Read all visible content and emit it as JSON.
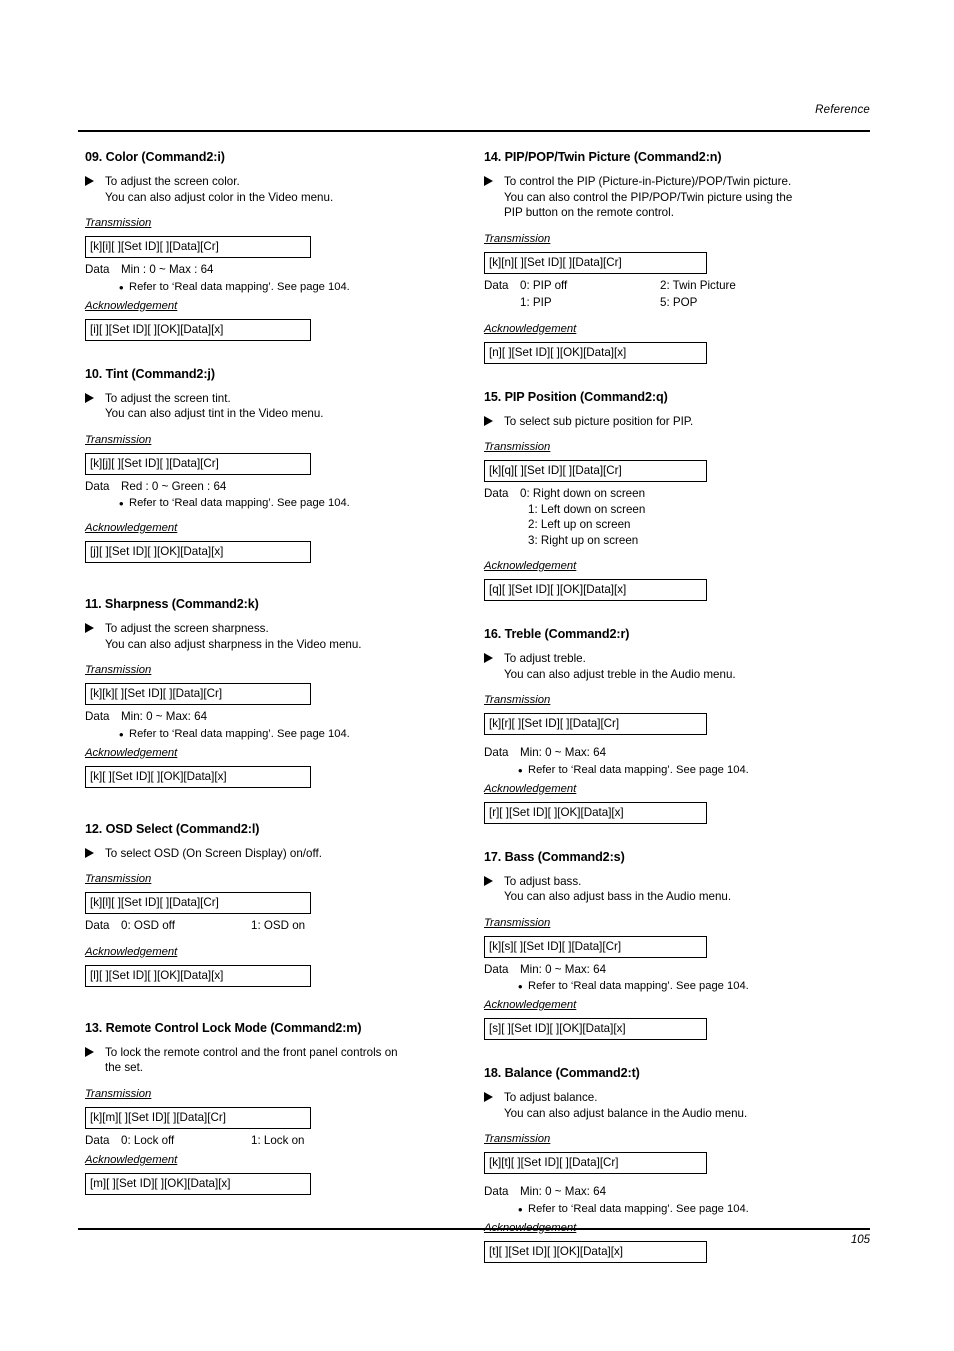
{
  "header": {
    "label": "Reference"
  },
  "footer": {
    "page": "105"
  },
  "labels": {
    "transmission": "Transmission",
    "acknowledgement": "Acknowledgement",
    "data": "Data",
    "note": "Refer to ‘Real data mapping’. See page 104."
  },
  "sections": [
    {
      "id": "09",
      "title": "09. Color (Command2:i)",
      "desc_line1": "To adjust the screen color.",
      "desc_line2": "You can also adjust color in the Video menu.",
      "tx": "[k][i][  ][Set ID][  ][Data][Cr]",
      "data_value": "Min : 0 ~ Max : 64",
      "note": "Refer to ‘Real data mapping’. See page 104.",
      "ack": "[i][  ][Set ID][  ][OK][Data][x]"
    },
    {
      "id": "10",
      "title": "10. Tint (Command2:j)",
      "desc_line1": "To adjust the screen tint.",
      "desc_line2": "You can also adjust tint in the Video menu.",
      "tx": "[k][j][  ][Set ID][  ][Data][Cr]",
      "data_value": "Red : 0 ~ Green : 64",
      "note": "Refer to ‘Real data mapping’. See page 104.",
      "ack": "[j][  ][Set ID][  ][OK][Data][x]"
    },
    {
      "id": "11",
      "title": "11. Sharpness (Command2:k)",
      "desc_line1": "To adjust the screen sharpness.",
      "desc_line2": "You can also adjust sharpness in the Video menu.",
      "tx": "[k][k][  ][Set ID][  ][Data][Cr]",
      "data_value": "Min: 0 ~ Max: 64",
      "note": "Refer to ‘Real data mapping’. See page 104.",
      "ack": "[k][  ][Set ID][  ][OK][Data][x]"
    },
    {
      "id": "12",
      "title": "12. OSD Select (Command2:l)",
      "desc_line1": "To select OSD (On Screen Display) on/off.",
      "tx": "[k][l][  ][Set ID][  ][Data][Cr]",
      "data_value": "0: OSD off",
      "data_value2": "1: OSD on",
      "ack": "[l][  ][Set ID][  ][OK][Data][x]"
    },
    {
      "id": "13",
      "title": "13. Remote Control Lock Mode (Command2:m)",
      "desc_line1": "To lock the remote control and the front panel controls on",
      "desc_line2": "the set.",
      "tx": "[k][m][  ][Set ID][  ][Data][Cr]",
      "data_value": "0: Lock off",
      "data_value2": "1: Lock on",
      "ack": "[m][  ][Set ID][  ][OK][Data][x]"
    },
    {
      "id": "14",
      "title": "14. PIP/POP/Twin Picture (Command2:n)",
      "desc_line1": "To control the PIP (Picture-in-Picture)/POP/Twin picture.",
      "desc_line2": "You can also control the PIP/POP/Twin picture using the",
      "desc_line3": "PIP button on the remote control.",
      "tx": "[k][n][  ][Set ID][  ][Data][Cr]",
      "data_value": "0: PIP off",
      "data_value2": "2: Twin Picture",
      "data_value_b": "1: PIP",
      "data_value2_b": "5: POP",
      "ack": "[n][  ][Set ID][  ][OK][Data][x]"
    },
    {
      "id": "15",
      "title": "15. PIP Position (Command2:q)",
      "desc_line1": "To select sub picture position for PIP.",
      "tx": "[k][q][  ][Set ID][  ][Data][Cr]",
      "data_list": [
        "0: Right down on screen",
        "1: Left down on screen",
        "2: Left up on screen",
        "3: Right up on screen"
      ],
      "ack": "[q][  ][Set ID][  ][OK][Data][x]"
    },
    {
      "id": "16",
      "title": "16. Treble (Command2:r)",
      "desc_line1": "To adjust treble.",
      "desc_line2": "You can also adjust treble in the Audio menu.",
      "tx": "[k][r][  ][Set ID][  ][Data][Cr]",
      "data_value": "Min: 0 ~ Max: 64",
      "note": "Refer to ‘Real data mapping’. See page 104.",
      "ack": "[r][  ][Set ID][  ][OK][Data][x]"
    },
    {
      "id": "17",
      "title": "17. Bass (Command2:s)",
      "desc_line1": "To adjust bass.",
      "desc_line2": "You can also adjust bass in the Audio menu.",
      "tx": "[k][s][  ][Set ID][  ][Data][Cr]",
      "data_value": "Min: 0 ~ Max: 64",
      "note": "Refer to ‘Real data mapping’. See page 104.",
      "ack": "[s][  ][Set ID][  ][OK][Data][x]"
    },
    {
      "id": "18",
      "title": "18. Balance (Command2:t)",
      "desc_line1": "To adjust balance.",
      "desc_line2": "You can also adjust balance in the Audio menu.",
      "tx": "[k][t][  ][Set ID][  ][Data][Cr]",
      "data_value": "Min: 0 ~ Max: 64",
      "note": "Refer to ‘Real data mapping’. See page 104.",
      "ack": "[t][  ][Set ID][  ][OK][Data][x]"
    }
  ]
}
